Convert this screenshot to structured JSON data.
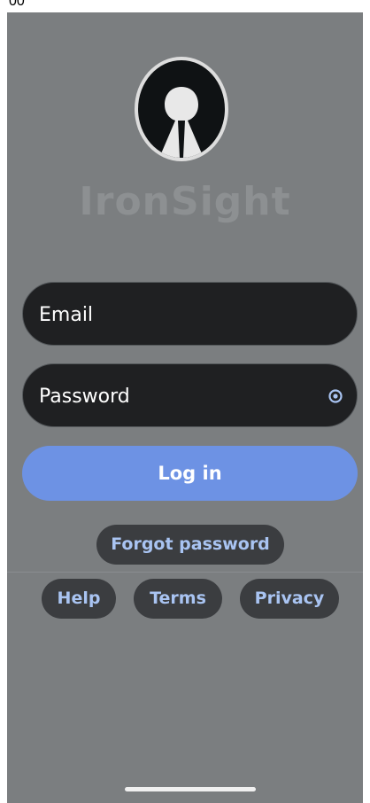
{
  "status_bar": {
    "time": "00"
  },
  "app": {
    "name": "IronSight"
  },
  "login_form": {
    "email_placeholder": "Email",
    "password_placeholder": "Password",
    "password_toggle_icon": "eye-icon",
    "login_label": "Log in",
    "forgot_label": "Forgot password"
  },
  "footer_links": {
    "help_label": "Help",
    "terms_label": "Terms",
    "privacy_label": "Privacy"
  },
  "colors": {
    "background": "#7b7e80",
    "field": "#1f2022",
    "primary_button": "#6d92e4",
    "link_pill": "#3b3d40",
    "link_text": "#a9c4f2"
  }
}
